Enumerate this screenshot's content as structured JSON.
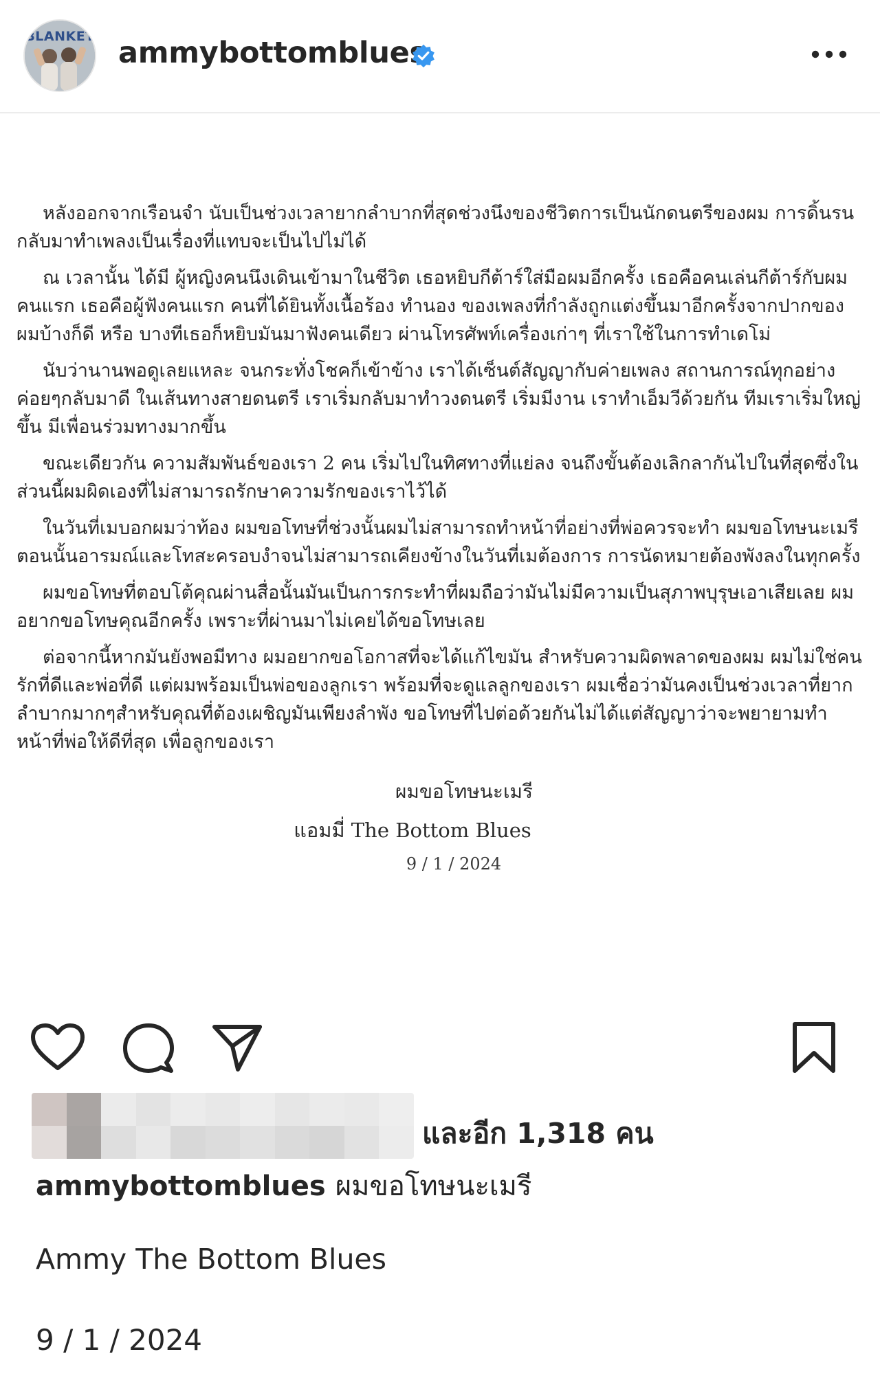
{
  "header": {
    "avatar_text": "BLANKET",
    "username": "ammybottomblues",
    "verified": true,
    "more_icon": "more-horizontal-icon"
  },
  "letter": {
    "paragraphs": [
      "หลังออกจากเรือนจำ นับเป็นช่วงเวลายากลำบากที่สุดช่วงนึงของชีวิตการเป็นนักดนตรีของผม การดิ้นรนกลับมาทำเพลงเป็นเรื่องที่แทบจะเป็นไปไม่ได้",
      "ณ เวลานั้น ได้มี ผู้หญิงคนนึงเดินเข้ามาในชีวิต เธอหยิบกีต้าร์ใส่มือผมอีกครั้ง เธอคือคนเล่นกีต้าร์กับผมคนแรก เธอคือผู้ฟังคนแรก คนที่ได้ยินทั้งเนื้อร้อง ทำนอง ของเพลงที่กำลังถูกแต่งขึ้นมาอีกครั้งจากปากของผมบ้างก็ดี หรือ บางทีเธอก็หยิบมันมาฟังคนเดียว ผ่านโทรศัพท์เครื่องเก่าๆ ที่เราใช้ในการทำเดโม่",
      "นับว่านานพอดูเลยแหละ จนกระทั่งโชคก็เข้าข้าง เราได้เซ็นต์สัญญากับค่ายเพลง สถานการณ์ทุกอย่างค่อยๆกลับมาดี ในเส้นทางสายดนตรี เราเริ่มกลับมาทำวงดนตรี เริ่มมีงาน เราทำเอ็มวีด้วยกัน ทีมเราเริ่มใหญ่ขึ้น มีเพื่อนร่วมทางมากขึ้น",
      "ขณะเดียวกัน ความสัมพันธ์ของเรา 2 คน เริ่มไปในทิศทางที่แย่ลง จนถึงขั้นต้องเลิกลากันไปในที่สุดซึ่งในส่วนนี้ผมผิดเองที่ไม่สามารถรักษาความรักของเราไว้ได้",
      "ในวันที่เมบอกผมว่าท้อง ผมขอโทษที่ช่วงนั้นผมไม่สามารถทำหน้าที่อย่างที่พ่อควรจะทำ ผมขอโทษนะเมรี ตอนนั้นอารมณ์และโทสะครอบงำจนไม่สามารถเคียงข้างในวันที่เมต้องการ การนัดหมายต้องพังลงในทุกครั้ง",
      "ผมขอโทษที่ตอบโต้คุณผ่านสื่อนั้นมันเป็นการกระทำที่ผมถือว่ามันไม่มีความเป็นสุภาพบุรุษเอาเสียเลย ผมอยากขอโทษคุณอีกครั้ง เพราะที่ผ่านมาไม่เคยได้ขอโทษเลย",
      "ต่อจากนี้หากมันยังพอมีทาง ผมอยากขอโอกาสที่จะได้แก้ไขมัน สำหรับความผิดพลาดของผม ผมไม่ใช่คนรักที่ดีและพ่อที่ดี แต่ผมพร้อมเป็นพ่อของลูกเรา พร้อมที่จะดูแลลูกของเรา ผมเชื่อว่ามันคงเป็นช่วงเวลาที่ยากลำบากมากๆสำหรับคุณที่ต้องเผชิญมันเพียงลำพัง ขอโทษที่ไปต่อด้วยกันไม่ได้แต่สัญญาว่าจะพยายามทำหน้าที่พ่อให้ดีที่สุด เพื่อลูกของเรา"
    ],
    "signoff": "ผมขอโทษนะเมรี",
    "signature": "แอมมี่ The Bottom Blues",
    "date": "9 / 1 / 2024"
  },
  "actions": {
    "like_icon": "heart-icon",
    "comment_icon": "comment-icon",
    "share_icon": "send-icon",
    "save_icon": "bookmark-icon"
  },
  "likes": {
    "text": "และอีก 1,318 คน"
  },
  "caption": {
    "username": "ammybottomblues",
    "text": "ผมขอโทษนะเมรี",
    "name_line": "Ammy The Bottom Blues",
    "date_line": "9 / 1 / 2024"
  },
  "colors": {
    "verified_blue": "#3897f0",
    "text": "#262626",
    "divider": "#ececec"
  }
}
